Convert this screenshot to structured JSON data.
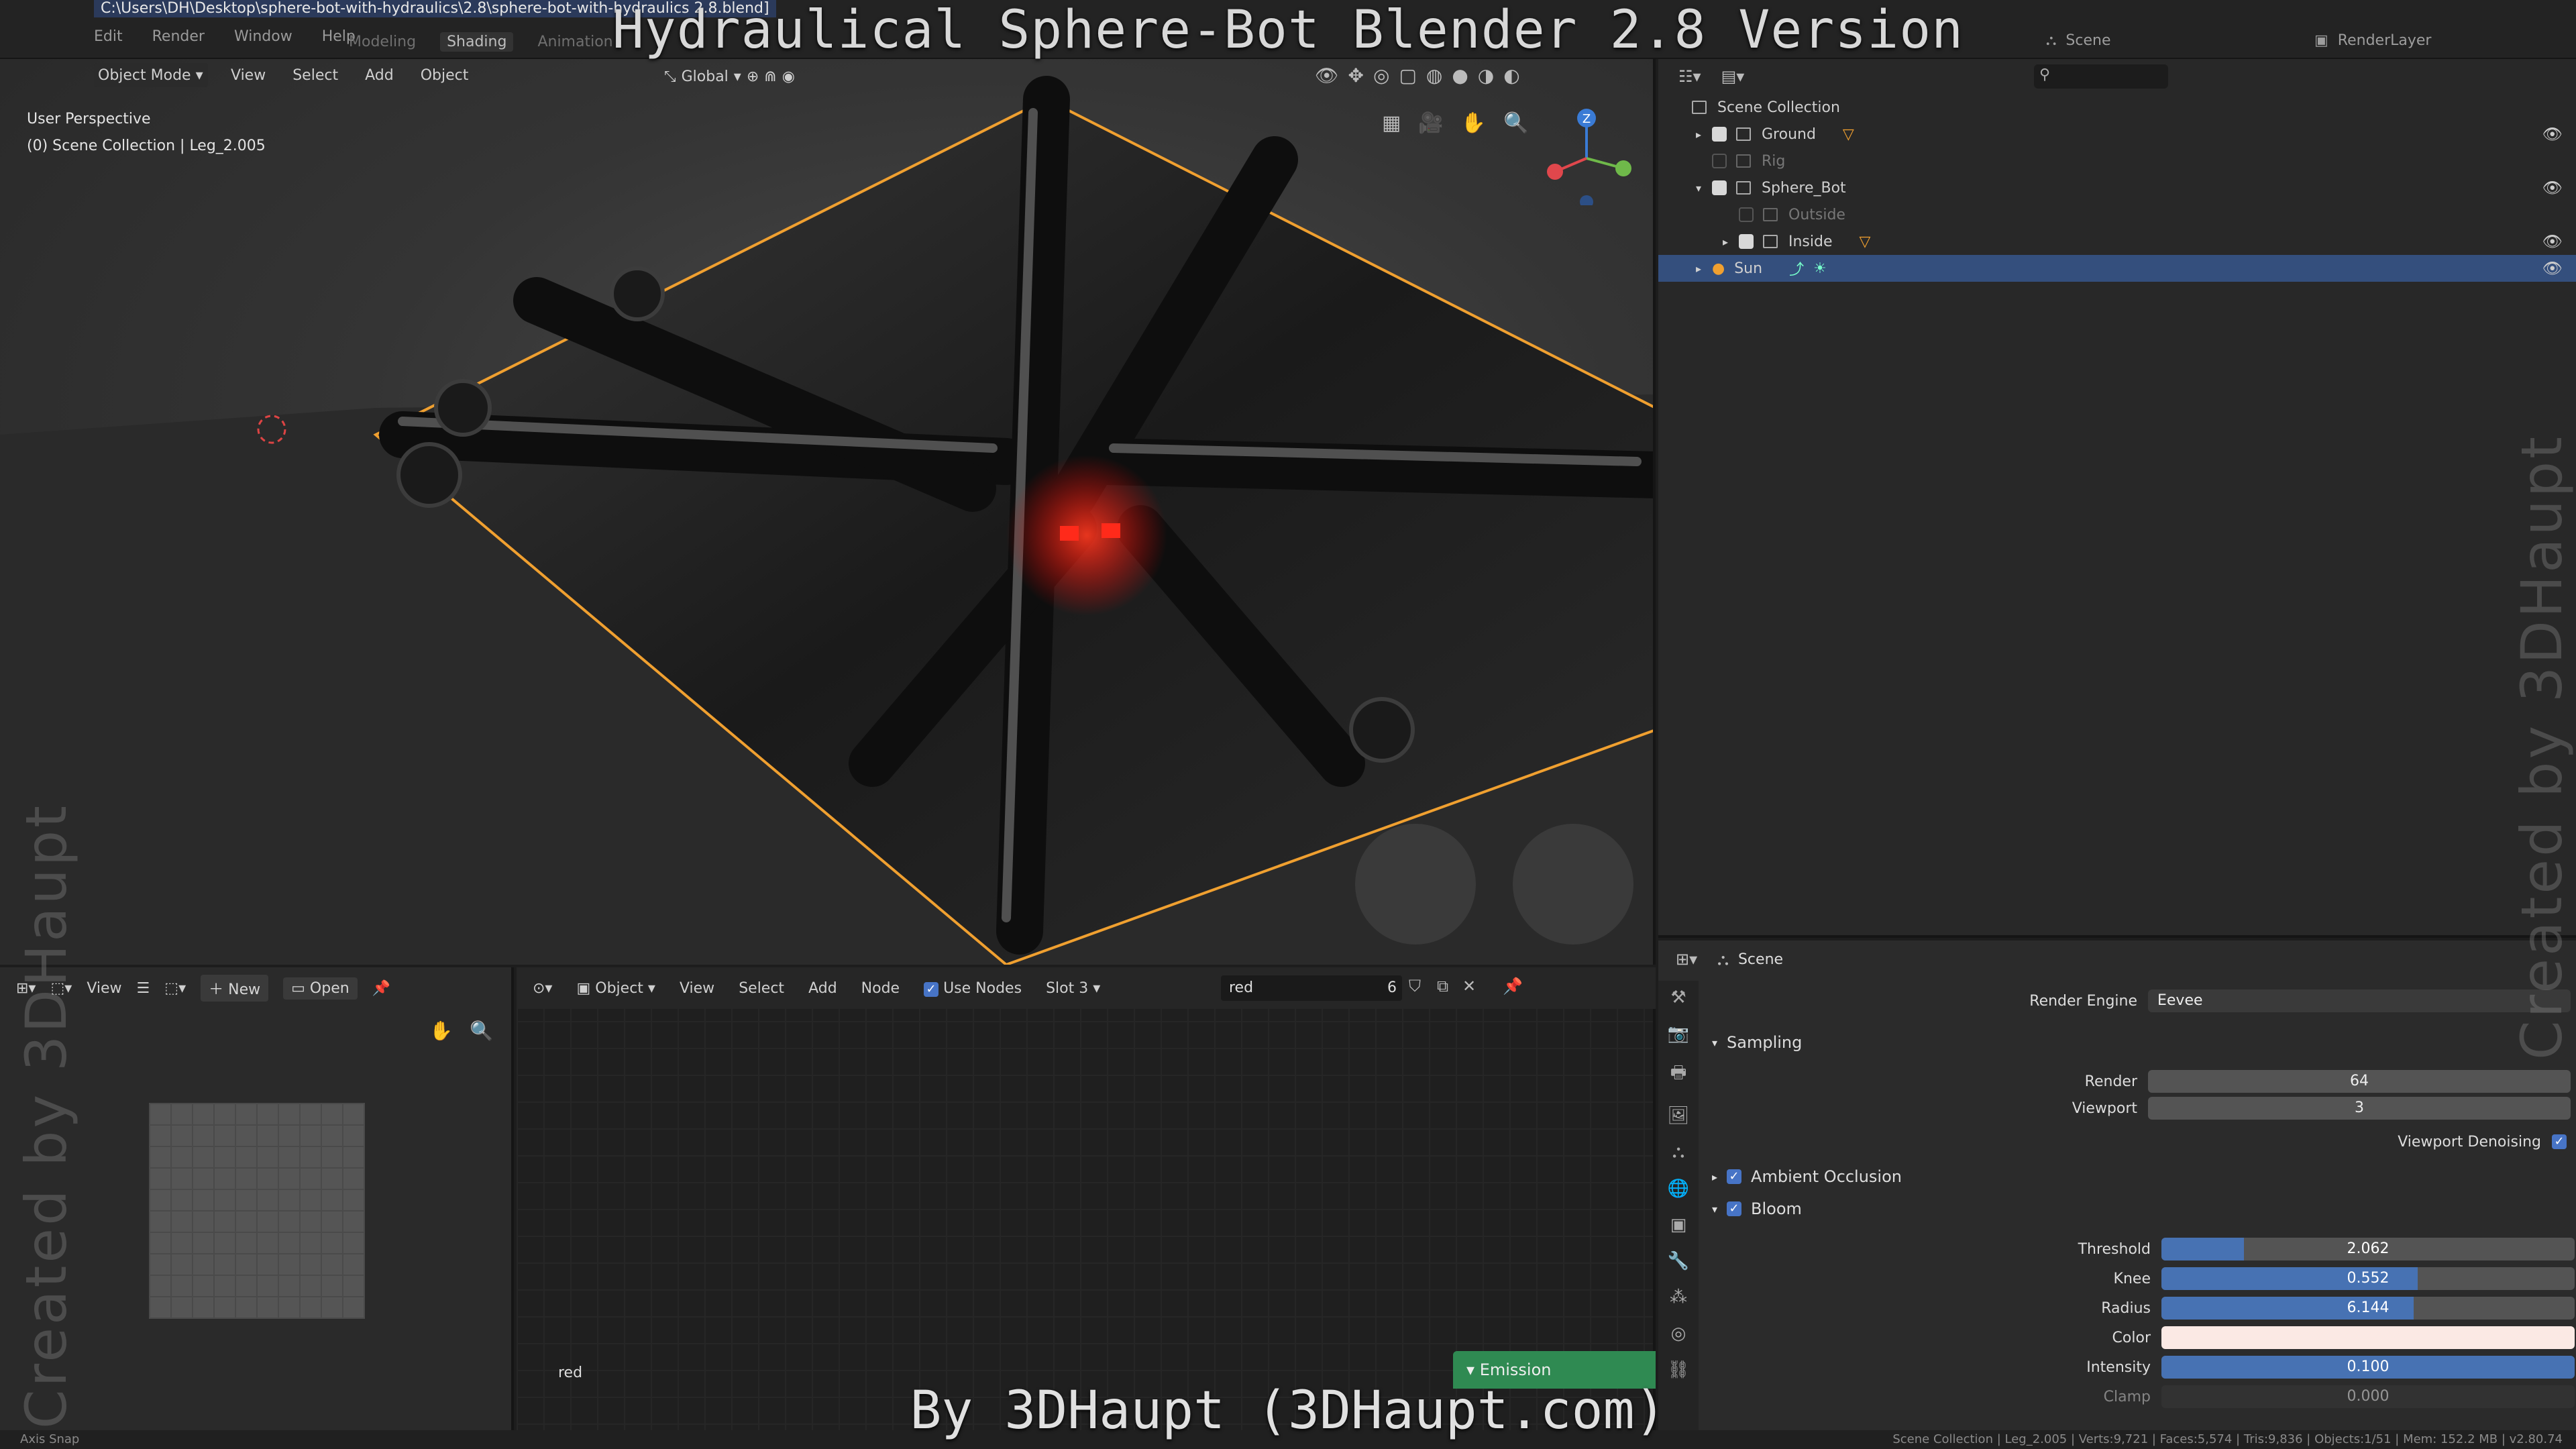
{
  "window": {
    "title_path": "C:\\Users\\DH\\Desktop\\sphere-bot-with-hydraulics\\2.8\\sphere-bot-with-hydraulics 2.8.blend]",
    "menu": [
      "Edit",
      "Render",
      "Window",
      "Help"
    ],
    "workspaces": [
      "Modeling",
      "Shading",
      "Animation"
    ],
    "active_workspace": "Shading",
    "scene": "Scene",
    "render_layer": "RenderLayer"
  },
  "overlay": {
    "title": "Hydraulical Sphere-Bot Blender 2.8 Version",
    "credit": "By 3DHaupt (3DHaupt.com)",
    "watermark": "Created by 3DHaupt"
  },
  "viewport": {
    "mode": "Object Mode",
    "menu": [
      "View",
      "Select",
      "Add",
      "Object"
    ],
    "transform_orientation": "Global",
    "perspective": "User Perspective",
    "collection_info": "(0) Scene Collection | Leg_2.005",
    "gizmo_axes": {
      "z": "Z",
      "y": "Y",
      "x": "X"
    }
  },
  "image_editor": {
    "view_label": "View",
    "new_label": "New",
    "open_label": "Open"
  },
  "node_editor": {
    "object_label": "Object",
    "menu": [
      "View",
      "Select",
      "Add",
      "Node"
    ],
    "use_nodes_label": "Use Nodes",
    "slot": "Slot 3",
    "material": "red",
    "user_count": "6",
    "tree_name": "red",
    "emission_node": "Emission"
  },
  "outliner": {
    "rows": [
      {
        "name": "Scene Collection",
        "level": 0,
        "checked": null,
        "state": "normal"
      },
      {
        "name": "Ground",
        "level": 1,
        "checked": true,
        "state": "normal"
      },
      {
        "name": "Rig",
        "level": 1,
        "checked": false,
        "state": "dim"
      },
      {
        "name": "Sphere_Bot",
        "level": 1,
        "checked": true,
        "state": "normal"
      },
      {
        "name": "Outside",
        "level": 2,
        "checked": false,
        "state": "dim"
      },
      {
        "name": "Inside",
        "level": 2,
        "checked": true,
        "state": "normal"
      },
      {
        "name": "Sun",
        "level": 1,
        "checked": null,
        "state": "selected"
      }
    ]
  },
  "properties": {
    "context": "Scene",
    "render_engine_label": "Render Engine",
    "render_engine": "Eevee",
    "sampling_label": "Sampling",
    "render_label": "Render",
    "render_samples": "64",
    "viewport_label": "Viewport",
    "viewport_samples": "3",
    "viewport_denoising_label": "Viewport Denoising",
    "ambient_occlusion_label": "Ambient Occlusion",
    "bloom_label": "Bloom",
    "threshold_label": "Threshold",
    "threshold": "2.062",
    "threshold_fill": 0.2,
    "knee_label": "Knee",
    "knee": "0.552",
    "knee_fill": 0.62,
    "radius_label": "Radius",
    "radius": "6.144",
    "radius_fill": 0.61,
    "color_label": "Color",
    "color": "#fbe9e4",
    "intensity_label": "Intensity",
    "intensity": "0.100",
    "intensity_fill": 1.0,
    "clamp_label": "Clamp",
    "clamp": "0.000"
  },
  "status": {
    "left": "Axis Snap",
    "right": "Scene Collection | Leg_2.005 | Verts:9,721 | Faces:5,574 | Tris:9,836 | Objects:1/51 | Mem: 152.2 MB | v2.80.74"
  },
  "colors": {
    "selection_outline": "#f0a030",
    "eye_glow": "#ff2a1a",
    "accent_blue": "#4772b3",
    "selected_row": "#344f7d",
    "emission_green": "#2f8a52"
  }
}
